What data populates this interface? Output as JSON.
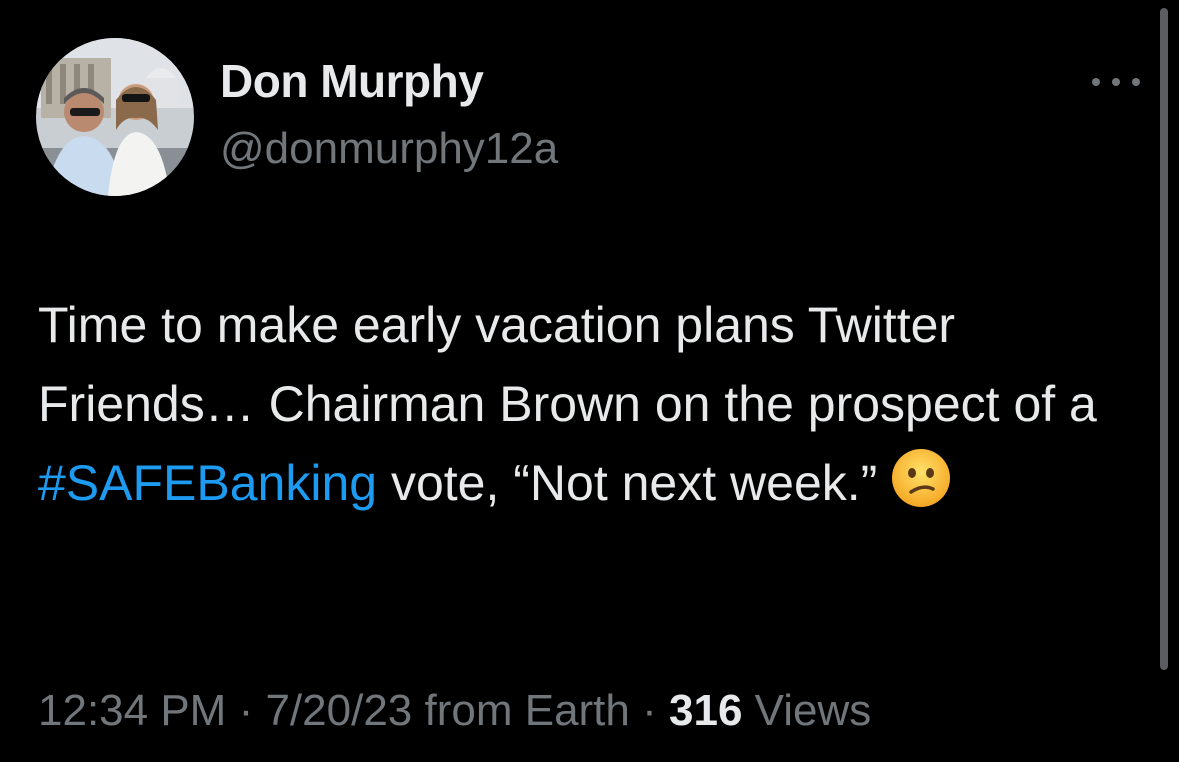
{
  "user": {
    "display_name": "Don Murphy",
    "handle": "@donmurphy12a"
  },
  "more_icon": "more-horizontal-icon",
  "tweet": {
    "text_before": "Time to make early vacation plans Twitter Friends… Chairman Brown on the prospect of a ",
    "hashtag": "#SAFEBanking",
    "text_after": " vote, “Not next week.”",
    "emoji": "confused-face-emoji"
  },
  "meta": {
    "time": "12:34 PM",
    "sep1": " · ",
    "date": "7/20/23",
    "source": " from Earth",
    "sep2": " · ",
    "views_count": "316",
    "views_label": " Views"
  },
  "colors": {
    "background": "#000000",
    "text": "#e7e9ea",
    "secondary": "#71767b",
    "link": "#1d9bf0"
  }
}
